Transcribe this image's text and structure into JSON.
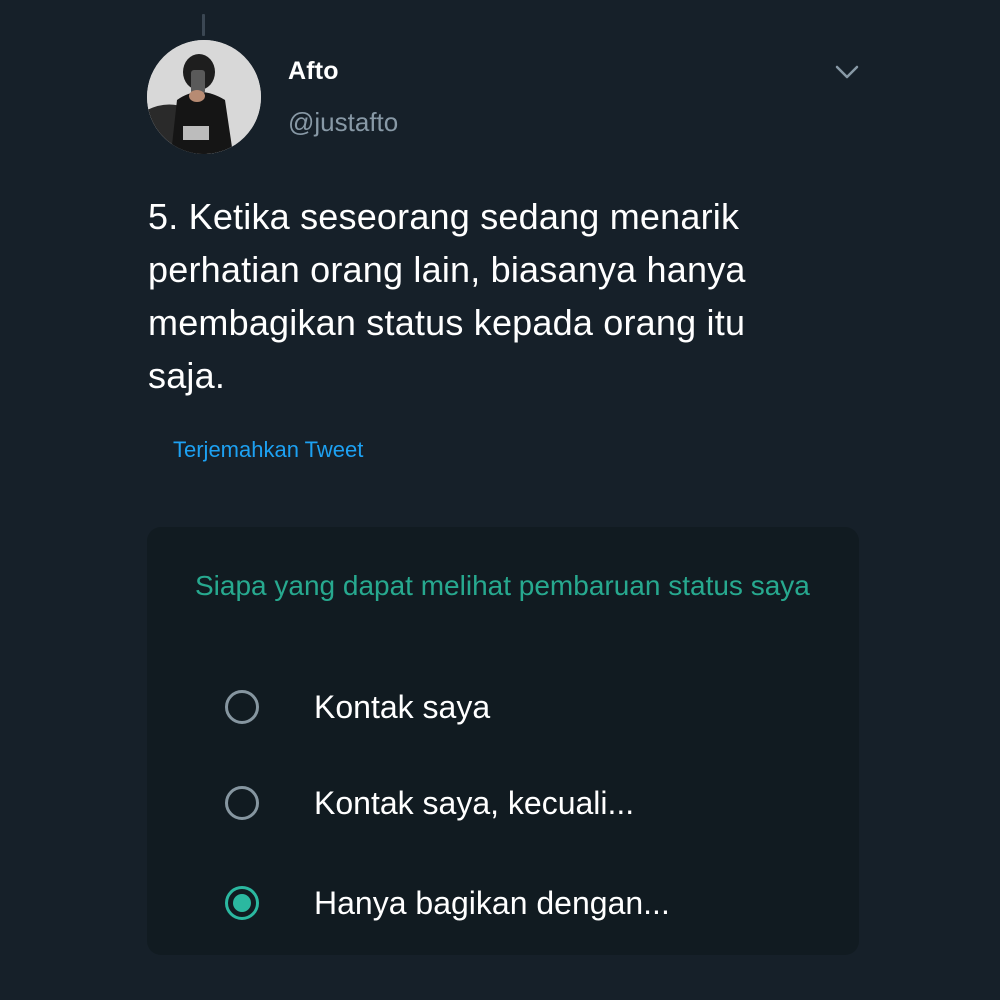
{
  "tweet": {
    "display_name": "Afto",
    "handle": "@justafto",
    "text": "5. Ketika seseorang sedang menarik\nperhatian orang lain, biasanya hanya\nmembagikan status kepada orang itu\nsaja.",
    "translate_label": "Terjemahkan Tweet",
    "more_icon": "chevron-down-icon"
  },
  "status_privacy": {
    "title": "Siapa yang dapat melihat pembaruan status saya",
    "options": [
      {
        "label": "Kontak saya",
        "selected": false
      },
      {
        "label": "Kontak saya, kecuali...",
        "selected": false
      },
      {
        "label": "Hanya bagikan dengan...",
        "selected": true
      }
    ]
  },
  "colors": {
    "background": "#162029",
    "accent_link": "#1da1f2",
    "accent_green": "#2bb8a0",
    "card_background": "#111b21",
    "muted_text": "#8899a6"
  }
}
